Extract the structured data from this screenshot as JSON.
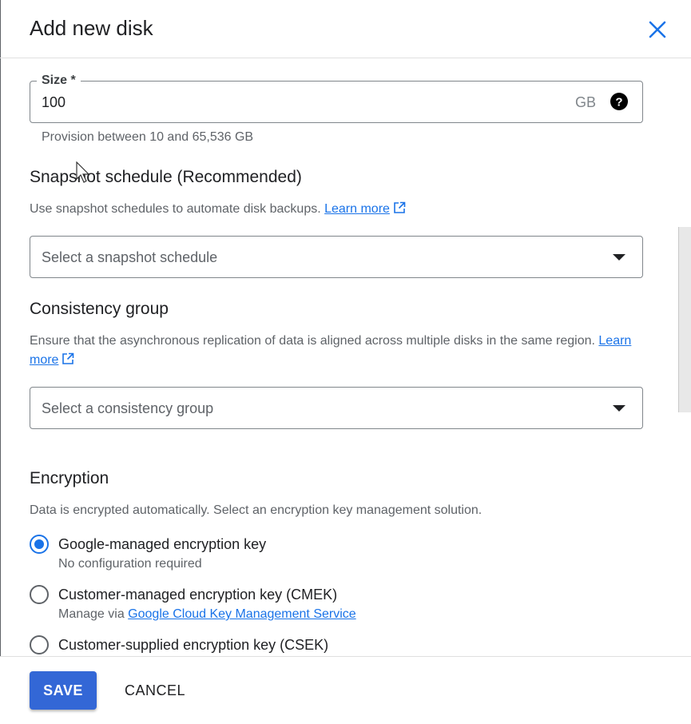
{
  "dialog": {
    "title": "Add new disk"
  },
  "icons": {
    "close": "close-icon",
    "help": "help-icon",
    "external": "open-in-new-icon",
    "dropdown": "arrow-drop-down-icon"
  },
  "size": {
    "legend": "Size *",
    "value": "100",
    "unit": "GB",
    "hint": "Provision between 10 and 65,536 GB"
  },
  "snapshot": {
    "title": "Snapshot schedule (Recommended)",
    "description": "Use snapshot schedules to automate disk backups.",
    "learn_more": "Learn more",
    "select_placeholder": "Select a snapshot schedule"
  },
  "consistency": {
    "title": "Consistency group",
    "description": "Ensure that the asynchronous replication of data is aligned across multiple disks in the same region.",
    "learn_more": "Learn more",
    "select_placeholder": "Select a consistency group"
  },
  "encryption": {
    "title": "Encryption",
    "description": "Data is encrypted automatically. Select an encryption key management solution.",
    "options": [
      {
        "label": "Google-managed encryption key",
        "sub": "No configuration required",
        "selected": true
      },
      {
        "label": "Customer-managed encryption key (CMEK)",
        "sub_prefix": "Manage via",
        "sub_link": "Google Cloud Key Management Service",
        "selected": false
      },
      {
        "label": "Customer-supplied encryption key (CSEK)",
        "selected": false
      }
    ]
  },
  "footer": {
    "save_label": "SAVE",
    "cancel_label": "CANCEL"
  },
  "colors": {
    "accent": "#1a73e8",
    "primary_button": "#3367d6"
  }
}
